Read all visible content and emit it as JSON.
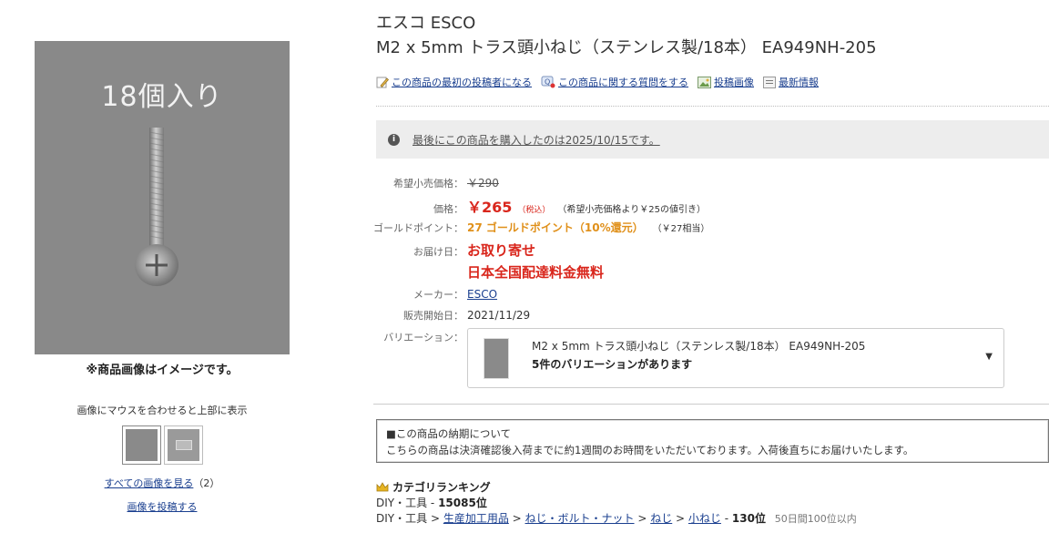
{
  "gallery": {
    "main_caption": "18個入り",
    "image_note": "※商品画像はイメージです。",
    "hover_note": "画像にマウスを合わせると上部に表示",
    "all_images_label": "すべての画像を見る",
    "all_images_count": "（2）",
    "post_image_label": "画像を投稿する"
  },
  "product": {
    "brand": "エスコ ESCO",
    "title": "M2 x 5mm トラス頭小ねじ（ステンレス製/18本） EA949NH-205"
  },
  "actions": [
    {
      "label": "この商品の最初の投稿者になる",
      "icon": "pencil-icon"
    },
    {
      "label": "この商品に関する質問をする",
      "icon": "question-icon"
    },
    {
      "label": "投稿画像",
      "icon": "image-icon"
    },
    {
      "label": "最新情報",
      "icon": "document-icon"
    }
  ],
  "last_bought": "最後にこの商品を購入したのは2025/10/15です。",
  "pricing": {
    "list_label": "希望小売価格：",
    "list_price": "￥290",
    "price_label": "価格：",
    "price": "￥265",
    "tax_note": "（税込）",
    "discount_note": "（希望小売価格より￥25の値引き）",
    "gold_label": "ゴールドポイント：",
    "gold_points": "27 ゴールドポイント（10%還元）",
    "gold_equiv": "（￥27相当）",
    "delivery_label": "お届け日：",
    "delivery_main": "お取り寄せ",
    "delivery_free": "日本全国配達料金無料",
    "maker_label": "メーカー：",
    "maker": "ESCO",
    "release_label": "販売開始日：",
    "release_date": "2021/11/29",
    "variation_label": "バリエーション："
  },
  "variation": {
    "name": "M2 x 5mm トラス頭小ねじ（ステンレス製/18本） EA949NH-205",
    "count": "5件のバリエーションがあります"
  },
  "notice": {
    "heading": "■この商品の納期について",
    "body": "こちらの商品は決済確認後入荷までに約1週間のお時間をいただいております。入荷後直ちにお届けいたします。"
  },
  "ranking": {
    "title": "カテゴリランキング",
    "line1_path": "DIY・工具 - ",
    "line1_rank": "15085位",
    "line2_root": "DIY・工具",
    "line2_links": [
      "生産加工用品",
      "ねじ・ボルト・ナット",
      "ねじ",
      "小ねじ"
    ],
    "line2_rank": "130位",
    "line2_sub": "50日間100位以内"
  },
  "colors": {
    "price_red": "#d9261c",
    "gold_orange": "#e0901a",
    "link_blue": "#1a3f8f"
  }
}
